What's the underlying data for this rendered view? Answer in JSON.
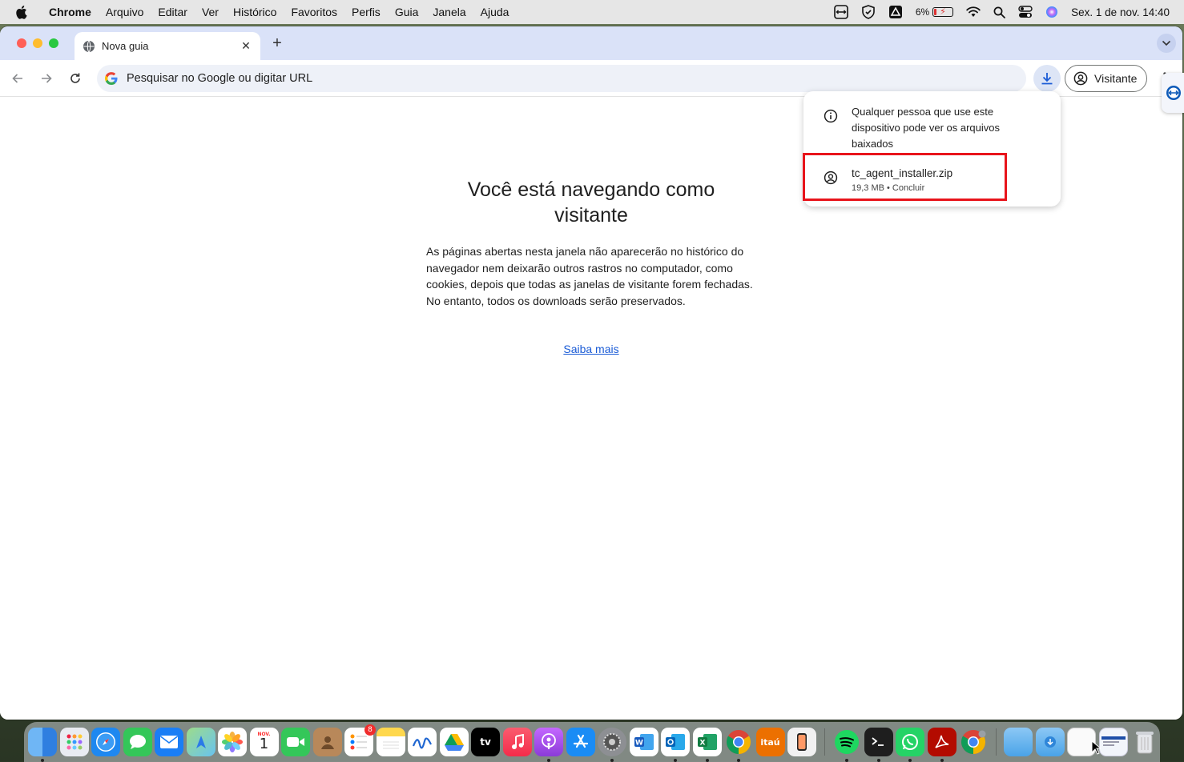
{
  "menubar": {
    "items": [
      "Chrome",
      "Arquivo",
      "Editar",
      "Ver",
      "Histórico",
      "Favoritos",
      "Perfis",
      "Guia",
      "Janela",
      "Ajuda"
    ],
    "battery_percent": "6%",
    "datetime": "Sex. 1 de nov.  14:40"
  },
  "browser": {
    "tab_title": "Nova guia",
    "omnibox_placeholder": "Pesquisar no Google ou digitar URL",
    "profile_label": "Visitante",
    "accent_color": "#dae2f8"
  },
  "page": {
    "title": "Você está navegando como visitante",
    "body": "As páginas abertas nesta janela não aparecerão no histórico do navegador nem deixarão outros rastros no computador, como cookies, depois que todas as janelas de visitante forem fechadas. No entanto, todos os downloads serão preservados.",
    "learn_more": "Saiba mais"
  },
  "downloads": {
    "info": "Qualquer pessoa que use este dispositivo pode ver os arquivos baixados",
    "file_name": "tc_agent_installer.zip",
    "file_meta": "19,3 MB • Concluir",
    "highlight_color": "#e8141b"
  },
  "dock": {
    "calendar_month": "NOV.",
    "calendar_day": "1",
    "reminders_badge": "8",
    "appletv_label": "tv",
    "itau_label": "itaú"
  }
}
